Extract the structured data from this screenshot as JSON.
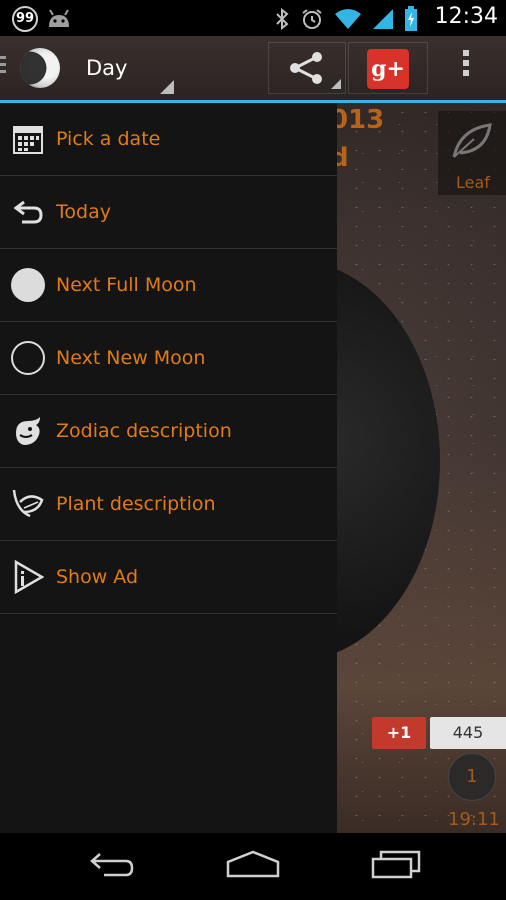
{
  "status_bar": {
    "notification_count": "99",
    "time": "12:34",
    "icons": [
      "bluetooth-icon",
      "alarm-icon",
      "wifi-icon",
      "signal-icon",
      "battery-charging-icon"
    ]
  },
  "action_bar": {
    "title": "Day",
    "app_icon": "moon-phase-icon",
    "actions": [
      "share-icon",
      "google-plus-icon",
      "overflow-menu-icon"
    ],
    "google_plus_label": "g+"
  },
  "drawer": {
    "items": [
      {
        "label": "Pick a date",
        "icon": "calendar-icon"
      },
      {
        "label": "Today",
        "icon": "undo-arrow-icon"
      },
      {
        "label": "Next Full Moon",
        "icon": "full-moon-icon"
      },
      {
        "label": "Next New Moon",
        "icon": "new-moon-icon"
      },
      {
        "label": "Zodiac description",
        "icon": "zodiac-bull-icon"
      },
      {
        "label": "Plant description",
        "icon": "plant-leaf-icon"
      },
      {
        "label": "Show Ad",
        "icon": "ad-play-icon"
      }
    ]
  },
  "background": {
    "date_fragment": "013",
    "subtitle_fragment": "d",
    "leaf_label": "Leaf",
    "plus_one_label": "+1",
    "plus_count": "445",
    "day_number": "1",
    "time": "19:11"
  },
  "colors": {
    "accent": "#e07b16",
    "divider_blue": "#33b5e5",
    "drawer_bg": "#141414"
  }
}
